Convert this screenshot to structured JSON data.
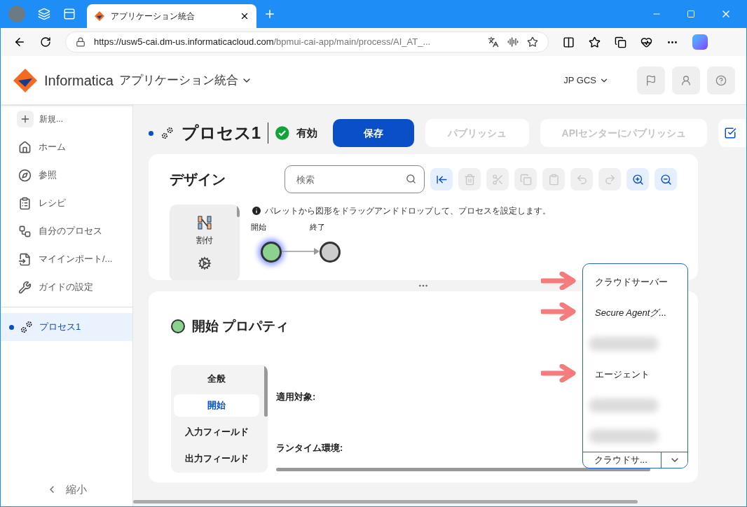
{
  "browser": {
    "tab_title": "アプリケーション統合",
    "url_host": "https://usw5-cai.dm-us.informaticacloud.com",
    "url_path": "/bpmui-cai-app/main/process/AI_AT_..."
  },
  "header": {
    "brand": "Informatica",
    "app": "アプリケーション統合",
    "org": "JP GCS"
  },
  "sidebar": {
    "new": "新規...",
    "items": [
      {
        "label": "ホーム",
        "kind": "home"
      },
      {
        "label": "参照",
        "kind": "compass"
      },
      {
        "label": "レシピ",
        "kind": "recipe"
      },
      {
        "label": "自分のプロセス",
        "kind": "process"
      },
      {
        "label": "マイインポート/...",
        "kind": "import"
      },
      {
        "label": "ガイドの設定",
        "kind": "wrench"
      }
    ],
    "open_items": [
      {
        "label": "プロセス1",
        "selected": true
      }
    ],
    "collapse": "縮小"
  },
  "process": {
    "title": "プロセス1",
    "status": "有効",
    "buttons": [
      {
        "label": "保存",
        "disabled": false
      },
      {
        "label": "パブリッシュ",
        "disabled": true
      },
      {
        "label": "APIセンターにパブリッシュ",
        "disabled": true
      }
    ]
  },
  "design": {
    "title": "デザイン",
    "search": {
      "placeholder": "検索"
    },
    "toolbar": [
      {
        "kind": "collapse",
        "disabled": false
      },
      {
        "kind": "delete",
        "disabled": true
      },
      {
        "kind": "cut",
        "disabled": true
      },
      {
        "kind": "copy",
        "disabled": true
      },
      {
        "kind": "paste",
        "disabled": true
      },
      {
        "kind": "undo",
        "disabled": true
      },
      {
        "kind": "redo",
        "disabled": true
      },
      {
        "kind": "zoom_in",
        "disabled": false
      },
      {
        "kind": "zoom_out",
        "disabled": false
      }
    ],
    "palette": [
      {
        "label": "割付"
      }
    ],
    "hint": "パレットから図形をドラッグアンドドロップして、プロセスを設定します。",
    "nodes": [
      {
        "label": "開始",
        "selected": true
      },
      {
        "label": "終了",
        "selected": false
      }
    ]
  },
  "properties": {
    "title": "開始 プロパティ",
    "tabs": [
      {
        "label": "全般",
        "selected": false
      },
      {
        "label": "開始",
        "selected": true
      },
      {
        "label": "入力フィールド",
        "selected": false
      },
      {
        "label": "出力フィールド",
        "selected": false
      }
    ],
    "fields": [
      {
        "label": "適用対象:"
      },
      {
        "label": "ランタイム環境:",
        "value": "クラウドサ...",
        "expanded": true
      }
    ],
    "dropdown": [
      {
        "kind": "text",
        "label": "クラウドサーバー",
        "italic": false,
        "pointed": true
      },
      {
        "kind": "text",
        "label": "Secure Agentグ...",
        "italic": true,
        "pointed": true
      },
      {
        "kind": "blurred"
      },
      {
        "kind": "text",
        "label": "エージェント",
        "italic": false,
        "pointed": true
      },
      {
        "kind": "blurred"
      },
      {
        "kind": "blurred"
      }
    ]
  }
}
